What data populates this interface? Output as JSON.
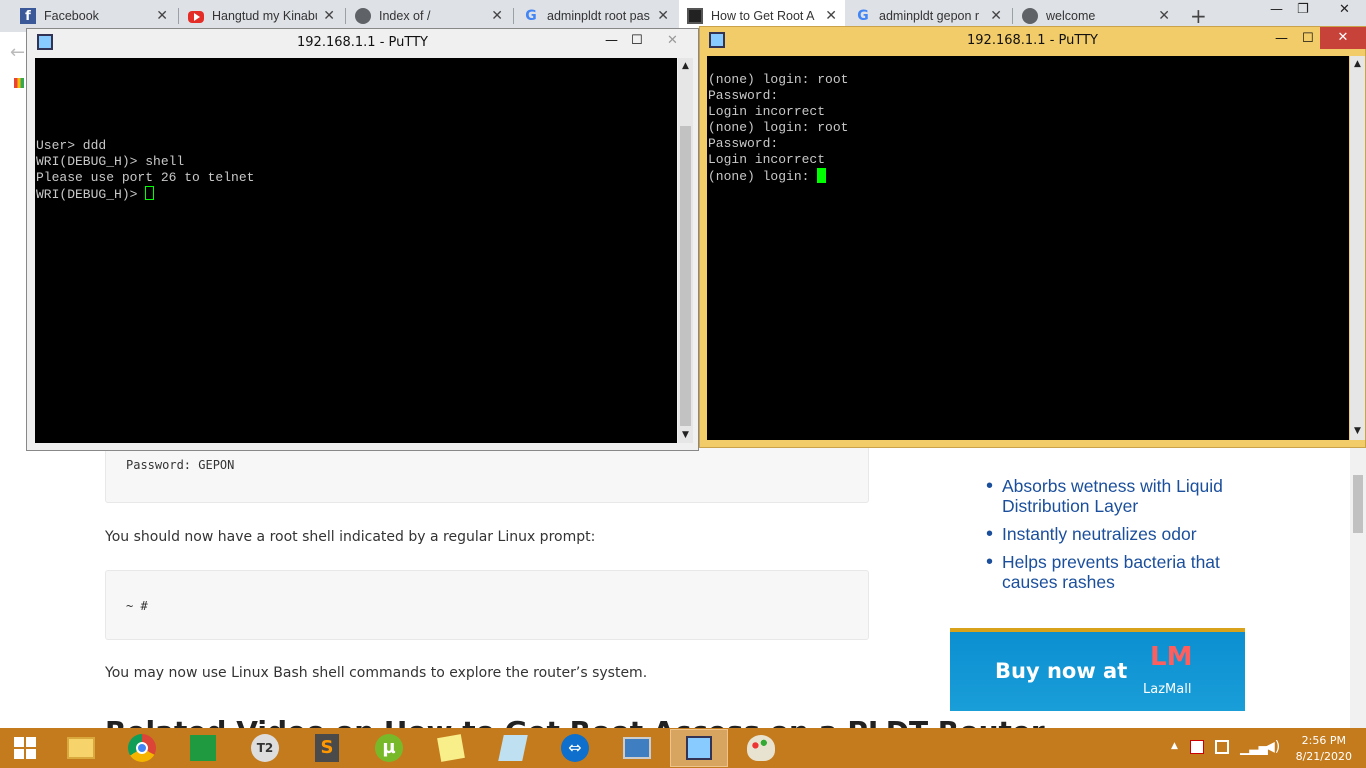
{
  "browser": {
    "tabs": [
      {
        "title": "Facebook",
        "icon": "facebook-icon"
      },
      {
        "title": "Hangtud my Kinabu",
        "icon": "youtube-icon"
      },
      {
        "title": "Index of /",
        "icon": "globe-icon"
      },
      {
        "title": "adminpldt root pas",
        "icon": "google-icon"
      },
      {
        "title": "How to Get Root A",
        "icon": "page-icon"
      },
      {
        "title": "adminpldt gepon r",
        "icon": "google-icon"
      },
      {
        "title": "welcome",
        "icon": "globe-icon"
      }
    ],
    "close_glyph": "✕",
    "new_tab_glyph": "+",
    "minimize_glyph": "—",
    "restore_glyph": "❐",
    "close_window_glyph": "✕",
    "back_glyph": "←"
  },
  "page": {
    "code1": "Password: GEPON",
    "para1": "You should now have a root shell indicated by a regular Linux prompt:",
    "code2": "~ #",
    "para2": "You may now use Linux Bash shell commands to explore the router’s system.",
    "heading": "Related Video on How to Get Root Access on a PLDT Router",
    "ad": {
      "bullets": [
        "Absorbs wetness with Liquid Distribution Layer",
        "Instantly neutralizes odor",
        "Helps prevents bacteria that causes rashes"
      ],
      "banner_text": "Buy now at",
      "brand_mark": "LM",
      "brand_name": "LazMall",
      "accent": "#1b4f9c"
    }
  },
  "putty_left": {
    "title": "192.168.1.1 - PuTTY",
    "lines": [
      "",
      "",
      "",
      "",
      "",
      "User> ddd",
      "WRI(DEBUG_H)> shell",
      "Please use port 26 to telnet",
      "WRI(DEBUG_H)> "
    ],
    "minimize": "—",
    "maximize": "☐",
    "close": "✕"
  },
  "putty_right": {
    "title": "192.168.1.1 - PuTTY",
    "lines": [
      "",
      "(none) login: root",
      "Password:",
      "Login incorrect",
      "(none) login: root",
      "Password:",
      "Login incorrect",
      "(none) login: "
    ],
    "minimize": "—",
    "maximize": "☐",
    "close": "✕",
    "cursor_color": "#00ff00",
    "frame_color": "#f3cc6a"
  },
  "taskbar": {
    "apps": [
      "windows-start-icon",
      "file-explorer-icon",
      "chrome-icon",
      "store-icon",
      "t2-icon",
      "sublime-icon",
      "utorrent-icon",
      "sticky-notes-icon",
      "notebook-icon",
      "teamviewer-icon",
      "remote-desktop-icon",
      "putty-icon",
      "paint-icon"
    ],
    "time": "2:56 PM",
    "date": "8/21/2020",
    "bar_color": "#c47b1d"
  }
}
